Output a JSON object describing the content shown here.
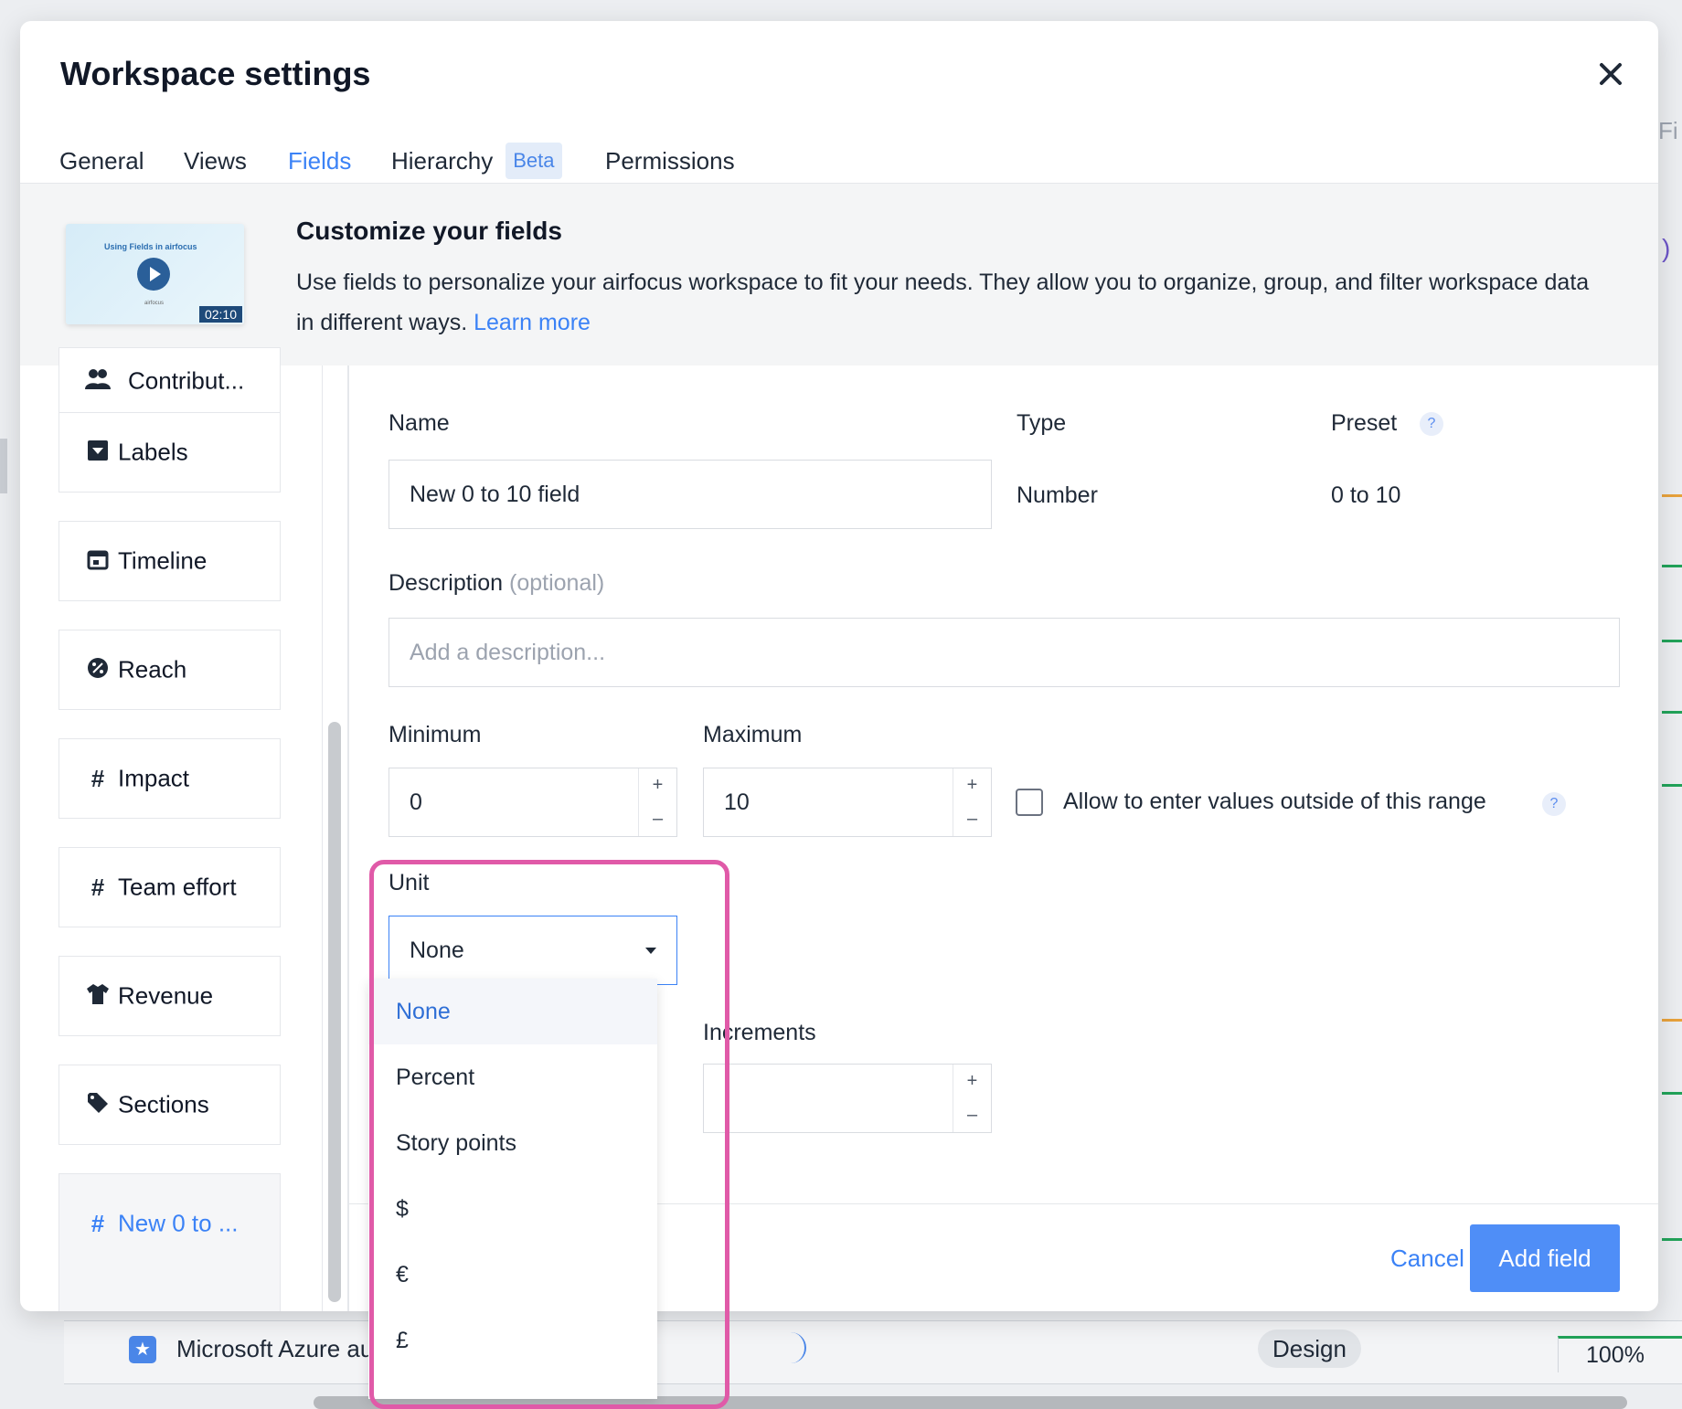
{
  "modal": {
    "title": "Workspace settings",
    "tabs": [
      {
        "label": "General"
      },
      {
        "label": "Views"
      },
      {
        "label": "Fields",
        "active": true
      },
      {
        "label": "Hierarchy",
        "badge": "Beta"
      },
      {
        "label": "Permissions"
      }
    ]
  },
  "banner": {
    "video_caption": "Using Fields in airfocus",
    "video_brand": "airfocus",
    "video_duration": "02:10",
    "title": "Customize your fields",
    "text": "Use fields to personalize your airfocus workspace to fit your needs. They allow you to organize, group, and filter workspace data in different ways.",
    "learn_more": "Learn more"
  },
  "sidebar": {
    "items": [
      {
        "label": "Contribut...",
        "icon": "people-icon"
      },
      {
        "label": "Labels",
        "icon": "label-dropdown-icon"
      },
      {
        "label": "Timeline",
        "icon": "calendar-icon"
      },
      {
        "label": "Reach",
        "icon": "percent-circle-icon"
      },
      {
        "label": "Impact",
        "icon": "hash-icon"
      },
      {
        "label": "Team effort",
        "icon": "hash-icon"
      },
      {
        "label": "Revenue",
        "icon": "shirt-icon"
      },
      {
        "label": "Sections",
        "icon": "tag-icon"
      },
      {
        "label": "New 0 to ...",
        "icon": "hash-icon",
        "active": true
      }
    ]
  },
  "form": {
    "name_label": "Name",
    "name_value": "New 0 to 10 field",
    "type_label": "Type",
    "type_value": "Number",
    "preset_label": "Preset",
    "preset_value": "0 to 10",
    "help_glyph": "?",
    "description_label": "Description",
    "description_optional": "(optional)",
    "description_placeholder": "Add a description...",
    "minimum_label": "Minimum",
    "minimum_value": "0",
    "maximum_label": "Maximum",
    "maximum_value": "10",
    "allow_outside_label": "Allow to enter values outside of this range",
    "unit_label": "Unit",
    "unit_value": "None",
    "unit_options": [
      "None",
      "Percent",
      "Story points",
      "$",
      "€",
      "£"
    ],
    "increments_label": "Increments",
    "plus": "+",
    "minus": "–"
  },
  "footer": {
    "cancel": "Cancel",
    "add": "Add field"
  },
  "background": {
    "row_title": "Microsoft Azure auth",
    "row_badge": "Design",
    "row_percent": "100%",
    "right_tab_fragment": "Fi",
    "right_paren": ")"
  },
  "colors": {
    "accent": "#3b82f6",
    "primary_button": "#4f8ef7",
    "highlight": "#e05aa8"
  }
}
